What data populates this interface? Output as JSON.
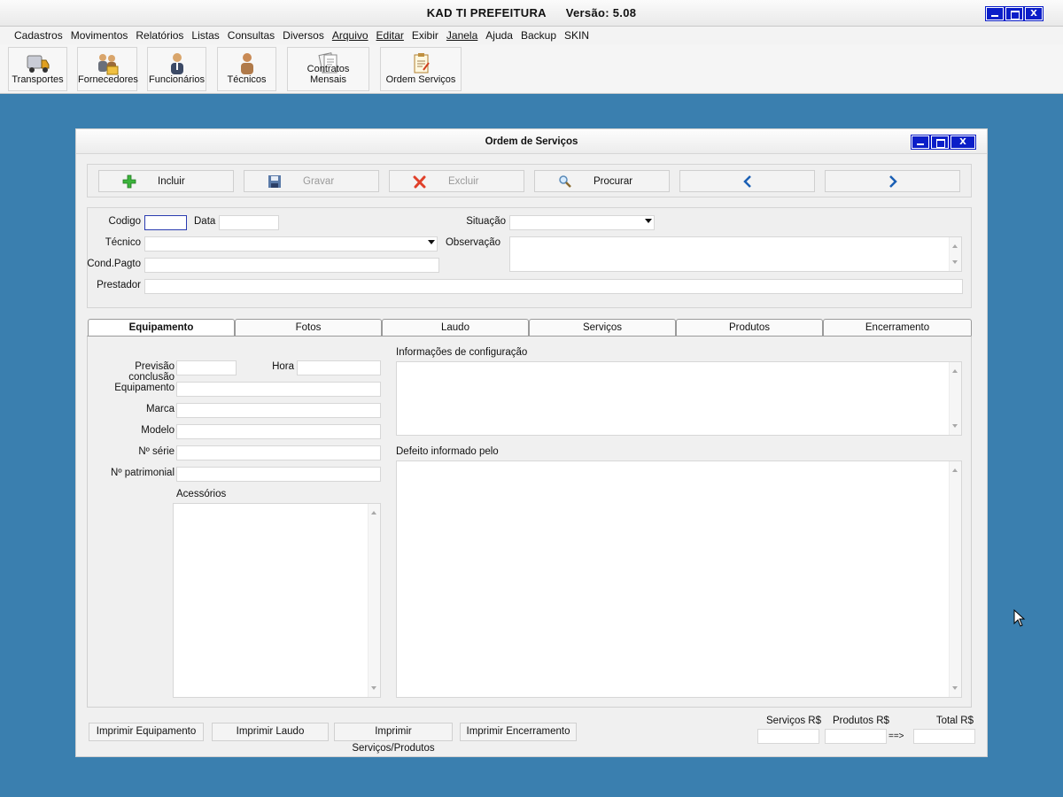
{
  "app": {
    "title": "KAD TI PREFEITURA",
    "version": "Versão: 5.08",
    "window_controls": {
      "minimize": "",
      "maximize": "",
      "close": "X"
    }
  },
  "menu": [
    "Cadastros",
    "Movimentos",
    "Relatórios",
    "Listas",
    "Consultas",
    "Diversos",
    "Arquivo",
    "Editar",
    "Exibir",
    "Janela",
    "Ajuda",
    "Backup",
    "SKIN"
  ],
  "toolbar": [
    {
      "label": "Transportes",
      "icon": "truck-icon"
    },
    {
      "label": "Fornecedores",
      "icon": "suppliers-icon"
    },
    {
      "label": "Funcionários",
      "icon": "employee-icon"
    },
    {
      "label": "Técnicos",
      "icon": "technician-icon"
    },
    {
      "label": "Contratos Mensais",
      "icon": "contracts-icon"
    },
    {
      "label": "Ordem Serviços",
      "icon": "service-order-icon"
    }
  ],
  "form": {
    "title": "Ordem de Serviços",
    "close": "X",
    "actions": {
      "incluir": "Incluir",
      "gravar": "Gravar",
      "excluir": "Excluir",
      "procurar": "Procurar"
    },
    "header_fields": {
      "codigo_label": "Codigo",
      "codigo_value": "",
      "data_label": "Data",
      "data_value": "",
      "situacao_label": "Situação",
      "situacao_value": "",
      "tecnico_label": "Técnico",
      "tecnico_value": "",
      "observacao_label": "Observação",
      "cond_pagto_label": "Cond.Pagto",
      "cond_pagto_value": "",
      "prestador_label": "Prestador",
      "prestador_value": ""
    },
    "tabs": [
      "Equipamento",
      "Fotos",
      "Laudo",
      "Serviços",
      "Produtos",
      "Encerramento"
    ],
    "active_tab": "Equipamento",
    "equipamento": {
      "previsao_label": "Previsão conclusão",
      "hora_label": "Hora",
      "equipamento_label": "Equipamento",
      "marca_label": "Marca",
      "modelo_label": "Modelo",
      "serie_label": "Nº série",
      "patrimonial_label": "Nº patrimonial",
      "acessorios_label": "Acessórios",
      "config_label": "Informações de configuração",
      "defeito_label": "Defeito informado pelo"
    },
    "print_buttons": {
      "equipamento": "Imprimir Equipamento",
      "laudo": "Imprimir Laudo",
      "servicos_produtos": "Imprimir Serviços/Produtos",
      "encerramento": "Imprimir Encerramento"
    },
    "totals": {
      "servicos_label": "Serviços R$",
      "produtos_label": "Produtos R$",
      "total_label": "Total R$",
      "arrow": "==>",
      "servicos_value": "",
      "produtos_value": "",
      "total_value": ""
    }
  },
  "colors": {
    "desktop": "#3a7faf",
    "window_button": "#0b1ec8",
    "nav_arrow": "#1a5fb4"
  }
}
